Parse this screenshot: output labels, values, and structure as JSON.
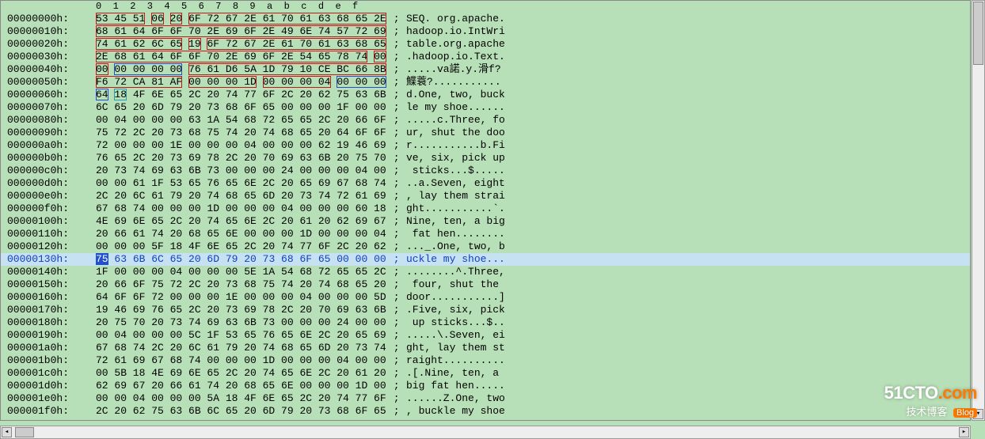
{
  "ruler": "0  1  2  3  4  5  6  7  8  9  a  b  c  d  e  f",
  "rows": [
    {
      "offset": "00000000h:",
      "segments": [
        {
          "text": "53 45 51",
          "cls": "box-red"
        },
        {
          "text": " "
        },
        {
          "text": "06",
          "cls": "box-red"
        },
        {
          "text": " "
        },
        {
          "text": "20",
          "cls": "box-red"
        },
        {
          "text": " "
        },
        {
          "text": "6F 72 67 2E 61 70 61 63 68 65 2E",
          "cls": "box-red"
        }
      ],
      "ascii": "SEQ. org.apache."
    },
    {
      "offset": "00000010h:",
      "segments": [
        {
          "text": "68 61 64 6F 6F 70 2E 69 6F 2E 49 6E 74 57 72 69",
          "cls": "box-red"
        }
      ],
      "ascii": "hadoop.io.IntWri"
    },
    {
      "offset": "00000020h:",
      "segments": [
        {
          "text": "74 61 62 6C 65",
          "cls": "box-red"
        },
        {
          "text": " "
        },
        {
          "text": "19",
          "cls": "box-red"
        },
        {
          "text": " "
        },
        {
          "text": "6F 72 67 2E 61 70 61 63 68 65",
          "cls": "box-red"
        }
      ],
      "ascii": "table.org.apache"
    },
    {
      "offset": "00000030h:",
      "segments": [
        {
          "text": "2E 68 61 64 6F 6F 70 2E 69 6F 2E 54 65 78 74",
          "cls": "box-red"
        },
        {
          "text": " "
        },
        {
          "text": "00",
          "cls": "box-red"
        }
      ],
      "ascii": ".hadoop.io.Text."
    },
    {
      "offset": "00000040h:",
      "segments": [
        {
          "text": "00",
          "cls": "box-red"
        },
        {
          "text": " "
        },
        {
          "text": "00 00 00 00",
          "cls": "box-blue"
        },
        {
          "text": " "
        },
        {
          "text": "76 61 D6 5A 1D 79 10 CE BC 66 8B",
          "cls": "box-red"
        }
      ],
      "ascii": ".....va諾.y.滑f?"
    },
    {
      "offset": "00000050h:",
      "segments": [
        {
          "text": "F6 72 CA 81 AF",
          "cls": "box-red"
        },
        {
          "text": " "
        },
        {
          "text": "00 00 00 1D",
          "cls": "box-red"
        },
        {
          "text": " "
        },
        {
          "text": "00 00 00 04",
          "cls": "box-red"
        },
        {
          "text": " "
        },
        {
          "text": "00 00 00",
          "cls": "box-blue"
        }
      ],
      "ascii": "鰈蓑?..........."
    },
    {
      "offset": "00000060h:",
      "segments": [
        {
          "text": "64",
          "cls": "box-blue"
        },
        {
          "text": " "
        },
        {
          "text": "18",
          "cls": "box-cyan"
        },
        {
          "text": " "
        },
        {
          "text": "4F 6E 65 2C 20 74 77 6F 2C 20 62 75 63 6B"
        }
      ],
      "ascii": "d.One, two, buck"
    },
    {
      "offset": "00000070h:",
      "segments": [
        {
          "text": "6C 65 20 6D 79 20 73 68 6F 65 00 00 00 1F 00 00"
        }
      ],
      "ascii": "le my shoe......"
    },
    {
      "offset": "00000080h:",
      "segments": [
        {
          "text": "00 04 00 00 00 63 1A 54 68 72 65 65 2C 20 66 6F"
        }
      ],
      "ascii": ".....c.Three, fo"
    },
    {
      "offset": "00000090h:",
      "segments": [
        {
          "text": "75 72 2C 20 73 68 75 74 20 74 68 65 20 64 6F 6F"
        }
      ],
      "ascii": "ur, shut the doo"
    },
    {
      "offset": "000000a0h:",
      "segments": [
        {
          "text": "72 00 00 00 1E 00 00 00 04 00 00 00 62 19 46 69"
        }
      ],
      "ascii": "r...........b.Fi"
    },
    {
      "offset": "000000b0h:",
      "segments": [
        {
          "text": "76 65 2C 20 73 69 78 2C 20 70 69 63 6B 20 75 70"
        }
      ],
      "ascii": "ve, six, pick up"
    },
    {
      "offset": "000000c0h:",
      "segments": [
        {
          "text": "20 73 74 69 63 6B 73 00 00 00 24 00 00 00 04 00"
        }
      ],
      "ascii": " sticks...$....."
    },
    {
      "offset": "000000d0h:",
      "segments": [
        {
          "text": "00 00 61 1F 53 65 76 65 6E 2C 20 65 69 67 68 74"
        }
      ],
      "ascii": "..a.Seven, eight"
    },
    {
      "offset": "000000e0h:",
      "segments": [
        {
          "text": "2C 20 6C 61 79 20 74 68 65 6D 20 73 74 72 61 69"
        }
      ],
      "ascii": ", lay them strai"
    },
    {
      "offset": "000000f0h:",
      "segments": [
        {
          "text": "67 68 74 00 00 00 1D 00 00 00 04 00 00 00 60 18"
        }
      ],
      "ascii": "ght...........`."
    },
    {
      "offset": "00000100h:",
      "segments": [
        {
          "text": "4E 69 6E 65 2C 20 74 65 6E 2C 20 61 20 62 69 67"
        }
      ],
      "ascii": "Nine, ten, a big"
    },
    {
      "offset": "00000110h:",
      "segments": [
        {
          "text": "20 66 61 74 20 68 65 6E 00 00 00 1D 00 00 00 04"
        }
      ],
      "ascii": " fat hen........"
    },
    {
      "offset": "00000120h:",
      "segments": [
        {
          "text": "00 00 00 5F 18 4F 6E 65 2C 20 74 77 6F 2C 20 62"
        }
      ],
      "ascii": "..._.One, two, b"
    },
    {
      "offset": "00000130h:",
      "highlight": true,
      "segments": [
        {
          "text": "75",
          "cls": "sel-blue"
        },
        {
          "text": " 63 6B 6C 65 20 6D 79 20 73 68 6F 65 00 00 00"
        }
      ],
      "ascii": "uckle my shoe..."
    },
    {
      "offset": "00000140h:",
      "segments": [
        {
          "text": "1F 00 00 00 04 00 00 00 5E 1A 54 68 72 65 65 2C"
        }
      ],
      "ascii": "........^.Three,"
    },
    {
      "offset": "00000150h:",
      "segments": [
        {
          "text": "20 66 6F 75 72 2C 20 73 68 75 74 20 74 68 65 20"
        }
      ],
      "ascii": " four, shut the "
    },
    {
      "offset": "00000160h:",
      "segments": [
        {
          "text": "64 6F 6F 72 00 00 00 1E 00 00 00 04 00 00 00 5D"
        }
      ],
      "ascii": "door...........]"
    },
    {
      "offset": "00000170h:",
      "segments": [
        {
          "text": "19 46 69 76 65 2C 20 73 69 78 2C 20 70 69 63 6B"
        }
      ],
      "ascii": ".Five, six, pick"
    },
    {
      "offset": "00000180h:",
      "segments": [
        {
          "text": "20 75 70 20 73 74 69 63 6B 73 00 00 00 24 00 00"
        }
      ],
      "ascii": " up sticks...$.."
    },
    {
      "offset": "00000190h:",
      "segments": [
        {
          "text": "00 04 00 00 00 5C 1F 53 65 76 65 6E 2C 20 65 69"
        }
      ],
      "ascii": ".....\\.Seven, ei"
    },
    {
      "offset": "000001a0h:",
      "segments": [
        {
          "text": "67 68 74 2C 20 6C 61 79 20 74 68 65 6D 20 73 74"
        }
      ],
      "ascii": "ght, lay them st"
    },
    {
      "offset": "000001b0h:",
      "segments": [
        {
          "text": "72 61 69 67 68 74 00 00 00 1D 00 00 00 04 00 00"
        }
      ],
      "ascii": "raight.........."
    },
    {
      "offset": "000001c0h:",
      "segments": [
        {
          "text": "00 5B 18 4E 69 6E 65 2C 20 74 65 6E 2C 20 61 20"
        }
      ],
      "ascii": ".[.Nine, ten, a "
    },
    {
      "offset": "000001d0h:",
      "segments": [
        {
          "text": "62 69 67 20 66 61 74 20 68 65 6E 00 00 00 1D 00"
        }
      ],
      "ascii": "big fat hen....."
    },
    {
      "offset": "000001e0h:",
      "segments": [
        {
          "text": "00 00 04 00 00 00 5A 18 4F 6E 65 2C 20 74 77 6F"
        }
      ],
      "ascii": "......Z.One, two"
    },
    {
      "offset": "000001f0h:",
      "segments": [
        {
          "text": "2C 20 62 75 63 6B 6C 65 20 6D 79 20 73 68 6F 65"
        }
      ],
      "ascii": ", buckle my shoe"
    }
  ],
  "separator": " ; ",
  "watermark": {
    "line1_a": "51CTO",
    "line1_b": ".com",
    "line2": "技术博客",
    "badge": "Blog"
  }
}
